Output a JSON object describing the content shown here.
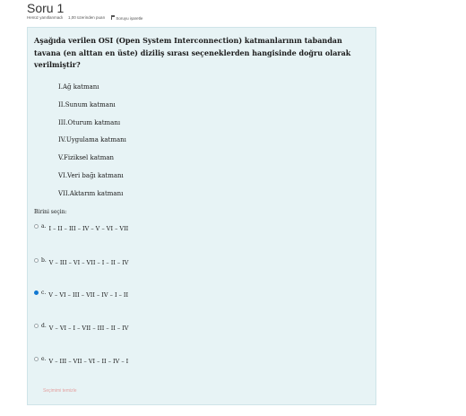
{
  "header": {
    "title": "Soru 1",
    "status": "Henüz yanıtlanmadı",
    "points": "1,00 üzerinden puan",
    "flag_label": "Soruyu işaretle"
  },
  "question": {
    "text": "Aşağıda verilen OSI (Open System Interconnection) katmanlarının tabandan tavana (en alttan en üste) diziliş sırası seçeneklerden hangisinde doğru olarak verilmiştir?",
    "items": [
      "I.Ağ katmanı",
      "II.Sunum katmanı",
      "III.Oturum katmanı",
      "IV.Uygulama katmanı",
      "V.Fiziksel katman",
      "VI.Veri bağı katmanı",
      "VII.Aktarım katmanı"
    ],
    "prompt": "Birini seçin:",
    "options": [
      {
        "label": "a.",
        "text": "I – II – III – IV – V – VI – VII",
        "selected": false
      },
      {
        "label": "b.",
        "text": "V – III – VI – VII – I – II – IV",
        "selected": false
      },
      {
        "label": "c.",
        "text": "V – VI – III – VII – IV – I – II",
        "selected": true
      },
      {
        "label": "d.",
        "text": "V – VI – I – VII – III – II – IV",
        "selected": false
      },
      {
        "label": "e.",
        "text": "V – III – VII – VI – II – IV – I",
        "selected": false
      }
    ],
    "clear_label": "Seçimimi temizle"
  },
  "colors": {
    "box_bg": "#e7f3f5",
    "radio_selected": "#1177d1",
    "clear_link": "#e4a1a1"
  }
}
